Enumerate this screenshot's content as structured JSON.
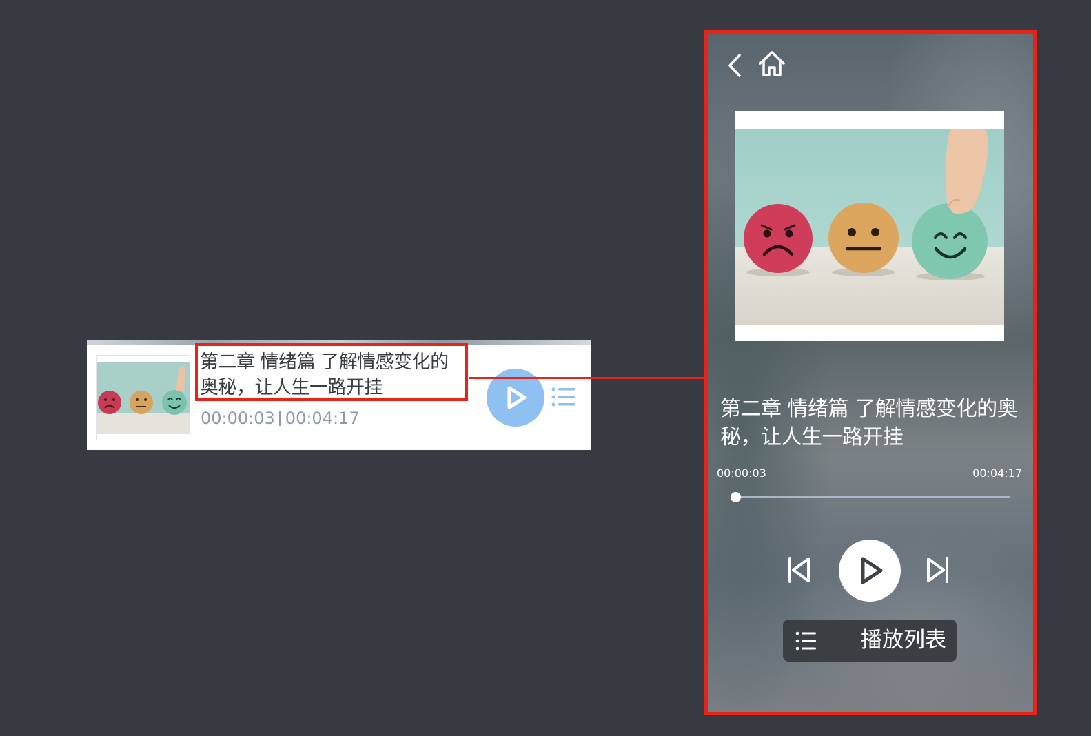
{
  "track": {
    "title": "第二章 情绪篇 了解情感变化的奥秘，让人生一路开挂",
    "current_time": "00:00:03",
    "total_time": "00:04:17",
    "progress": 0.0117
  },
  "playlist_button": {
    "label": "播放列表"
  },
  "cover": {
    "faces": [
      "sad",
      "neutral",
      "happy"
    ]
  },
  "colors": {
    "page_background": "#373a41",
    "highlight_red": "#e8241a",
    "mini_play_button": "#8ec0f1",
    "time_text": "#8e9aaa",
    "playlist_button_bg": "#3b3f44"
  },
  "icons": [
    "back-icon",
    "home-icon",
    "play-icon",
    "list-icon",
    "prev-track-icon",
    "next-track-icon"
  ]
}
